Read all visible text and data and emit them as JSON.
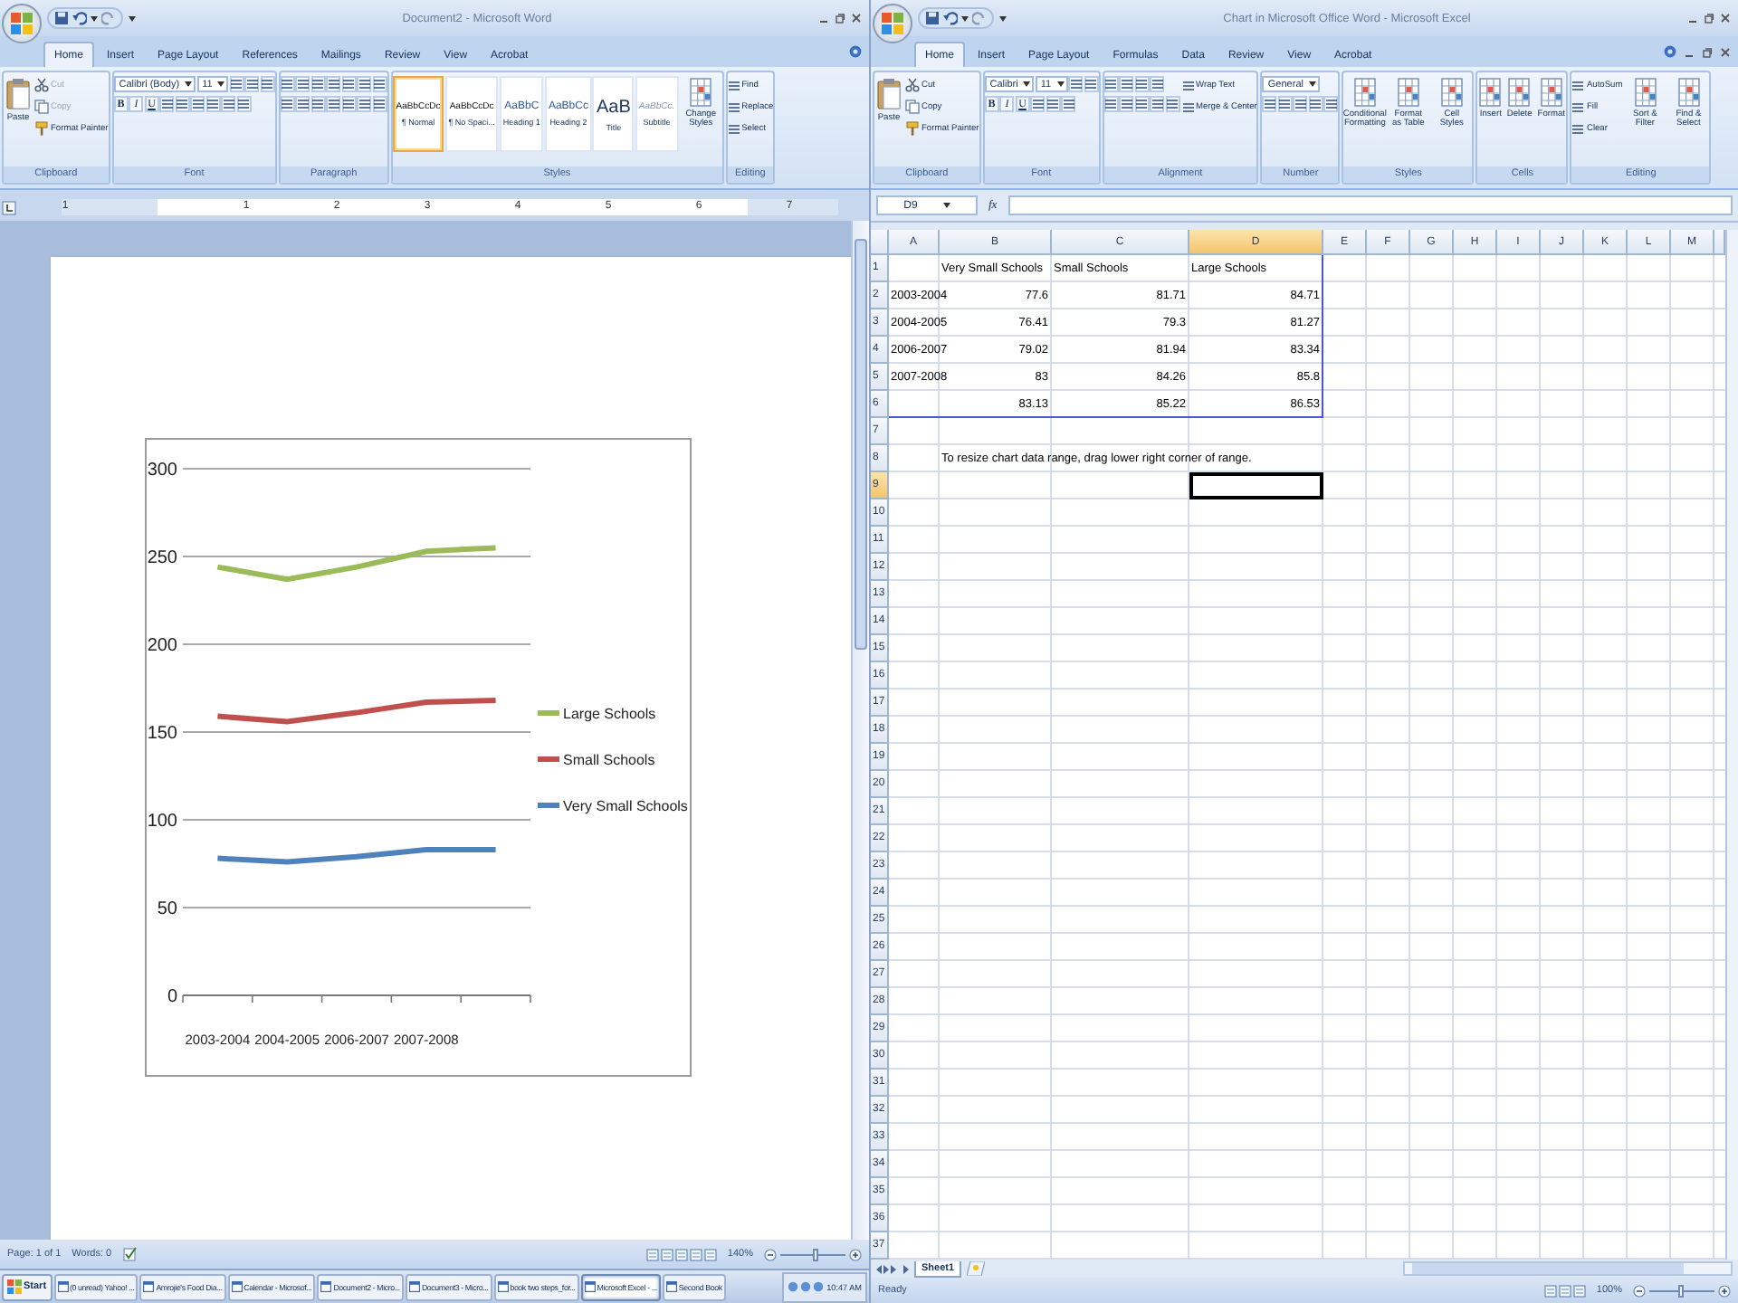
{
  "word": {
    "title": "Document2 - Microsoft Word",
    "tabs": [
      {
        "label": "Home",
        "selected": true
      },
      {
        "label": "Insert",
        "selected": false
      },
      {
        "label": "Page Layout",
        "selected": false
      },
      {
        "label": "References",
        "selected": false
      },
      {
        "label": "Mailings",
        "selected": false
      },
      {
        "label": "Review",
        "selected": false
      },
      {
        "label": "View",
        "selected": false
      },
      {
        "label": "Acrobat",
        "selected": false
      }
    ],
    "groups": [
      {
        "label": "Clipboard",
        "cols": [
          [
            [
              {
                "kind": "paste",
                "label": "Paste",
                "disabled": false
              }
            ]
          ],
          [
            [
              {
                "kind": "cut",
                "label": "Cut",
                "disabled": true
              }
            ],
            [
              {
                "kind": "copy",
                "label": "Copy",
                "disabled": true
              }
            ],
            [
              {
                "kind": "brush",
                "label": "Format Painter",
                "disabled": false
              }
            ]
          ]
        ]
      },
      {
        "label": "Font",
        "cols": [
          [
            [
              {
                "kind": "field",
                "value": "Calibri (Body)"
              },
              {
                "kind": "field",
                "value": "11"
              },
              {
                "kind": "tool"
              },
              {
                "kind": "tool"
              },
              {
                "kind": "tool"
              }
            ],
            [
              {
                "kind": "bold",
                "label": "B"
              },
              {
                "kind": "italic",
                "label": "I"
              },
              {
                "kind": "underline",
                "label": "U"
              },
              {
                "kind": "tool"
              },
              {
                "kind": "tool"
              },
              {
                "kind": "tool"
              },
              {
                "kind": "tool"
              },
              {
                "kind": "tool"
              },
              {
                "kind": "tool"
              }
            ]
          ]
        ]
      },
      {
        "label": "Paragraph",
        "cols": [
          [
            [
              {
                "kind": "tool"
              },
              {
                "kind": "tool"
              },
              {
                "kind": "tool"
              },
              {
                "kind": "tool"
              },
              {
                "kind": "tool"
              },
              {
                "kind": "tool"
              },
              {
                "kind": "tool"
              }
            ],
            [
              {
                "kind": "tool"
              },
              {
                "kind": "tool"
              },
              {
                "kind": "tool"
              },
              {
                "kind": "tool"
              },
              {
                "kind": "tool"
              },
              {
                "kind": "tool"
              },
              {
                "kind": "tool"
              }
            ]
          ]
        ]
      },
      {
        "label": "Styles",
        "cols": [
          [
            [
              {
                "kind": "style",
                "preview": "AaBbCcDc",
                "label": "¶ Normal",
                "selected": true
              },
              {
                "kind": "style",
                "preview": "AaBbCcDc",
                "label": "¶ No Spaci...",
                "selected": false
              },
              {
                "kind": "style",
                "preview": "AaBbC",
                "label": "Heading 1",
                "selected": false
              },
              {
                "kind": "style",
                "preview": "AaBbCc",
                "label": "Heading 2",
                "selected": false
              },
              {
                "kind": "style",
                "preview": "AaB",
                "label": "Title",
                "selected": false
              },
              {
                "kind": "style",
                "preview": "AaBbCc.",
                "label": "Subtitle",
                "selected": false
              }
            ]
          ],
          [
            [
              {
                "kind": "big",
                "label": "Change Styles"
              }
            ]
          ]
        ]
      },
      {
        "label": "Editing",
        "cols": [
          [
            [
              {
                "kind": "small",
                "label": "Find"
              }
            ],
            [
              {
                "kind": "small",
                "label": "Replace"
              }
            ],
            [
              {
                "kind": "small",
                "label": "Select"
              }
            ]
          ]
        ]
      }
    ],
    "ruler": [
      "1",
      "1",
      "2",
      "3",
      "4",
      "5",
      "6",
      "7"
    ],
    "chart_data": {
      "type": "line",
      "grid": true,
      "legend": true,
      "categories": [
        "2003-2004",
        "2004-2005",
        "2006-2007",
        "2007-2008",
        null
      ],
      "ylim": [
        0,
        300
      ],
      "yticks": [
        0,
        50,
        100,
        150,
        200,
        250,
        300
      ],
      "series": [
        {
          "name": "Very Small Schools",
          "color": "#4f81bd",
          "values": [
            78,
            76,
            79,
            83,
            83
          ]
        },
        {
          "name": "Small Schools",
          "color": "#c0504d",
          "values": [
            159,
            156,
            161,
            167,
            168
          ]
        },
        {
          "name": "Large Schools",
          "color": "#9bbb59",
          "values": [
            244,
            237,
            244,
            253,
            255
          ]
        }
      ]
    },
    "status": {
      "page": "Page: 1 of 1",
      "words": "Words: 0",
      "zoom": "140%",
      "zoom_slider": {
        "level": 0.56
      }
    }
  },
  "excel": {
    "title": "Chart in Microsoft Office Word - Microsoft Excel",
    "tabs": [
      {
        "label": "Home",
        "selected": true
      },
      {
        "label": "Insert",
        "selected": false
      },
      {
        "label": "Page Layout",
        "selected": false
      },
      {
        "label": "Formulas",
        "selected": false
      },
      {
        "label": "Data",
        "selected": false
      },
      {
        "label": "Review",
        "selected": false
      },
      {
        "label": "View",
        "selected": false
      },
      {
        "label": "Acrobat",
        "selected": false
      }
    ],
    "groups": [
      {
        "label": "Clipboard",
        "cols": [
          [
            [
              {
                "kind": "paste",
                "label": "Paste",
                "disabled": false
              }
            ]
          ],
          [
            [
              {
                "kind": "cut",
                "label": "Cut",
                "disabled": false
              }
            ],
            [
              {
                "kind": "copy",
                "label": "Copy",
                "disabled": false
              }
            ],
            [
              {
                "kind": "brush",
                "label": "Format Painter",
                "disabled": false
              }
            ]
          ]
        ]
      },
      {
        "label": "Font",
        "cols": [
          [
            [
              {
                "kind": "field",
                "value": "Calibri"
              },
              {
                "kind": "field",
                "value": "11"
              },
              {
                "kind": "tool"
              },
              {
                "kind": "tool"
              }
            ],
            [
              {
                "kind": "bold",
                "label": "B"
              },
              {
                "kind": "italic",
                "label": "I"
              },
              {
                "kind": "underline",
                "label": "U"
              },
              {
                "kind": "tool"
              },
              {
                "kind": "tool"
              },
              {
                "kind": "tool"
              }
            ]
          ]
        ]
      },
      {
        "label": "Alignment",
        "cols": [
          [
            [
              {
                "kind": "tool"
              },
              {
                "kind": "tool"
              },
              {
                "kind": "tool"
              },
              {
                "kind": "tool"
              }
            ],
            [
              {
                "kind": "tool"
              },
              {
                "kind": "tool"
              },
              {
                "kind": "tool"
              },
              {
                "kind": "tool"
              },
              {
                "kind": "tool"
              }
            ]
          ],
          [
            [
              {
                "kind": "small",
                "label": "Wrap Text"
              }
            ],
            [
              {
                "kind": "small",
                "label": "Merge & Center"
              }
            ]
          ]
        ]
      },
      {
        "label": "Number",
        "cols": [
          [
            [
              {
                "kind": "field",
                "value": "General"
              }
            ],
            [
              {
                "kind": "tool"
              },
              {
                "kind": "tool"
              },
              {
                "kind": "tool"
              },
              {
                "kind": "tool"
              },
              {
                "kind": "tool"
              }
            ]
          ]
        ]
      },
      {
        "label": "Styles",
        "cols": [
          [
            [
              {
                "kind": "big",
                "label": "Conditional Formatting"
              }
            ]
          ],
          [
            [
              {
                "kind": "big",
                "label": "Format as Table"
              }
            ]
          ],
          [
            [
              {
                "kind": "big",
                "label": "Cell Styles"
              }
            ]
          ]
        ]
      },
      {
        "label": "Cells",
        "cols": [
          [
            [
              {
                "kind": "big",
                "label": "Insert"
              }
            ]
          ],
          [
            [
              {
                "kind": "big",
                "label": "Delete"
              }
            ]
          ],
          [
            [
              {
                "kind": "big",
                "label": "Format"
              }
            ]
          ]
        ]
      },
      {
        "label": "Editing",
        "cols": [
          [
            [
              {
                "kind": "small",
                "label": "AutoSum"
              }
            ],
            [
              {
                "kind": "small",
                "label": "Fill"
              }
            ],
            [
              {
                "kind": "small",
                "label": "Clear"
              }
            ]
          ],
          [
            [
              {
                "kind": "big",
                "label": "Sort & Filter"
              }
            ]
          ],
          [
            [
              {
                "kind": "big",
                "label": "Find & Select"
              }
            ]
          ]
        ]
      }
    ],
    "name_box": "D9",
    "function_button": "fx",
    "columns": [
      {
        "label": "A",
        "selected": false
      },
      {
        "label": "B",
        "selected": false
      },
      {
        "label": "C",
        "selected": false
      },
      {
        "label": "D",
        "selected": true
      },
      {
        "label": "E",
        "selected": false
      },
      {
        "label": "F",
        "selected": false
      },
      {
        "label": "G",
        "selected": false
      },
      {
        "label": "H",
        "selected": false
      },
      {
        "label": "I",
        "selected": false
      },
      {
        "label": "J",
        "selected": false
      },
      {
        "label": "K",
        "selected": false
      },
      {
        "label": "L",
        "selected": false
      },
      {
        "label": "M",
        "selected": false
      }
    ],
    "rows": [
      {
        "label": "1",
        "selected": false,
        "kind": "header",
        "cells": [
          null,
          "Very Small Schools",
          "Small Schools",
          "Large Schools"
        ]
      },
      {
        "label": "2",
        "selected": false,
        "kind": "data",
        "cells": [
          "2003-2004",
          "77.6",
          "81.71",
          "84.71"
        ]
      },
      {
        "label": "3",
        "selected": false,
        "kind": "data",
        "cells": [
          "2004-2005",
          "76.41",
          "79.3",
          "81.27"
        ]
      },
      {
        "label": "4",
        "selected": false,
        "kind": "data",
        "cells": [
          "2006-2007",
          "79.02",
          "81.94",
          "83.34"
        ]
      },
      {
        "label": "5",
        "selected": false,
        "kind": "data",
        "cells": [
          "2007-2008",
          "83",
          "84.26",
          "85.8"
        ]
      },
      {
        "label": "6",
        "selected": false,
        "kind": "data",
        "cells": [
          null,
          "83.13",
          "85.22",
          "86.53"
        ]
      },
      {
        "label": "7",
        "selected": false,
        "kind": "empty"
      },
      {
        "label": "8",
        "selected": false,
        "kind": "note",
        "cells": [
          null,
          "To resize chart data range, drag lower right corner of range."
        ]
      },
      {
        "label": "9",
        "selected": true,
        "kind": "empty"
      },
      {
        "label": "10",
        "selected": false,
        "kind": "empty"
      },
      {
        "label": "11",
        "selected": false,
        "kind": "empty"
      },
      {
        "label": "12",
        "selected": false,
        "kind": "empty"
      },
      {
        "label": "13",
        "selected": false,
        "kind": "empty"
      },
      {
        "label": "14",
        "selected": false,
        "kind": "empty"
      },
      {
        "label": "15",
        "selected": false,
        "kind": "empty"
      },
      {
        "label": "16",
        "selected": false,
        "kind": "empty"
      },
      {
        "label": "17",
        "selected": false,
        "kind": "empty"
      },
      {
        "label": "18",
        "selected": false,
        "kind": "empty"
      },
      {
        "label": "19",
        "selected": false,
        "kind": "empty"
      },
      {
        "label": "20",
        "selected": false,
        "kind": "empty"
      },
      {
        "label": "21",
        "selected": false,
        "kind": "empty"
      },
      {
        "label": "22",
        "selected": false,
        "kind": "empty"
      },
      {
        "label": "23",
        "selected": false,
        "kind": "empty"
      },
      {
        "label": "24",
        "selected": false,
        "kind": "empty"
      },
      {
        "label": "25",
        "selected": false,
        "kind": "empty"
      },
      {
        "label": "26",
        "selected": false,
        "kind": "empty"
      },
      {
        "label": "27",
        "selected": false,
        "kind": "empty"
      },
      {
        "label": "28",
        "selected": false,
        "kind": "empty"
      },
      {
        "label": "29",
        "selected": false,
        "kind": "empty"
      },
      {
        "label": "30",
        "selected": false,
        "kind": "empty"
      },
      {
        "label": "31",
        "selected": false,
        "kind": "empty"
      },
      {
        "label": "32",
        "selected": false,
        "kind": "empty"
      },
      {
        "label": "33",
        "selected": false,
        "kind": "empty"
      },
      {
        "label": "34",
        "selected": false,
        "kind": "empty"
      },
      {
        "label": "35",
        "selected": false,
        "kind": "empty"
      },
      {
        "label": "36",
        "selected": false,
        "kind": "empty"
      },
      {
        "label": "37",
        "selected": false,
        "kind": "empty"
      }
    ],
    "sheets": [
      {
        "label": "Sheet1",
        "selected": true
      }
    ],
    "status": {
      "text": "Ready",
      "zoom": "100%",
      "zoom_slider": {
        "level": 0.5
      }
    }
  },
  "taskbar": {
    "start": "Start",
    "items": [
      {
        "label": "(0 unread) Yahoo! ...",
        "selected": false
      },
      {
        "label": "Amrojie's Food Dia...",
        "selected": false
      },
      {
        "label": "Calendar - Microsof...",
        "selected": false
      },
      {
        "label": "Document2 - Micro...",
        "selected": false
      },
      {
        "label": "Document3 - Micro...",
        "selected": false
      },
      {
        "label": "book two steps_for...",
        "selected": false
      },
      {
        "label": "Microsoft Excel - ...",
        "selected": true
      },
      {
        "label": "Second Book",
        "selected": false
      }
    ],
    "clock": "10:47 AM"
  }
}
